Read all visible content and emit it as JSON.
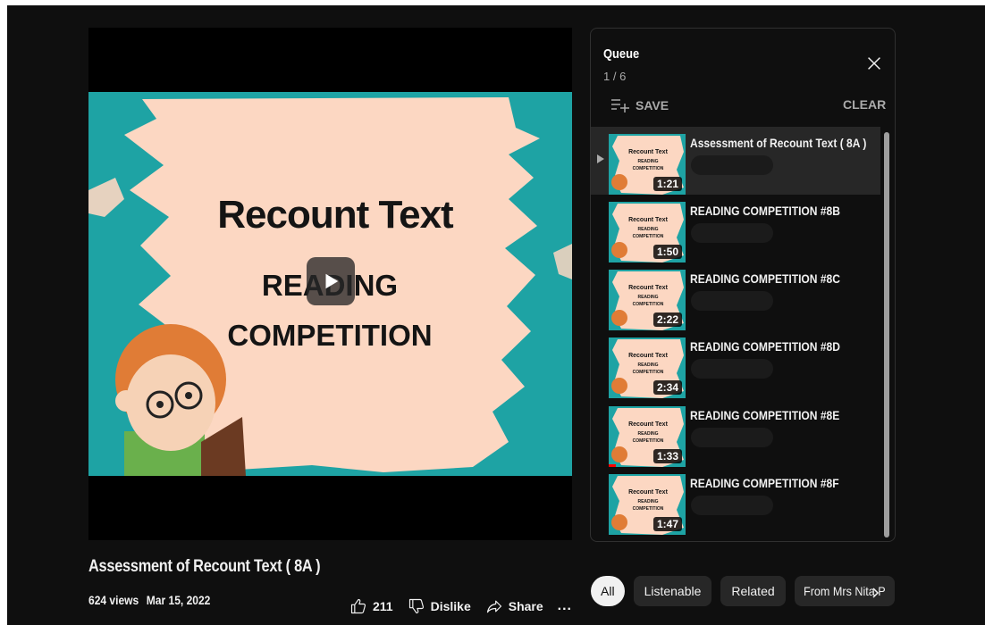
{
  "player": {
    "thumbnail": {
      "heading": "Recount Text",
      "line1": "READING",
      "line2": "COMPETITION",
      "colors": {
        "peach": "#fcd7c2",
        "teal": "#1ea3a4",
        "dark": "#141414"
      }
    },
    "play_icon": "play-icon"
  },
  "video": {
    "title": "Assessment of Recount Text ( 8A )",
    "views": "624 views",
    "date": "Mar 15, 2022",
    "likes": "211",
    "dislike_label": "Dislike",
    "share_label": "Share",
    "more_label": "..."
  },
  "queue": {
    "title": "Queue",
    "position": "1 / 6",
    "save_label": "SAVE",
    "clear_label": "CLEAR",
    "items": [
      {
        "title": "Assessment of Recount Text ( 8A )",
        "duration": "1:21",
        "active": true
      },
      {
        "title": "READING COMPETITION #8B",
        "duration": "1:50"
      },
      {
        "title": "READING COMPETITION #8C",
        "duration": "2:22"
      },
      {
        "title": "READING COMPETITION #8D",
        "duration": "2:34"
      },
      {
        "title": "READING COMPETITION #8E",
        "duration": "1:33"
      },
      {
        "title": "READING COMPETITION #8F",
        "duration": "1:47"
      }
    ],
    "thumb_text": {
      "heading": "Recount Text",
      "line1": "READING",
      "line2": "COMPETITION"
    }
  },
  "chips": {
    "all": "All",
    "listenable": "Listenable",
    "related": "Related",
    "from": "From Mrs Nita P"
  }
}
